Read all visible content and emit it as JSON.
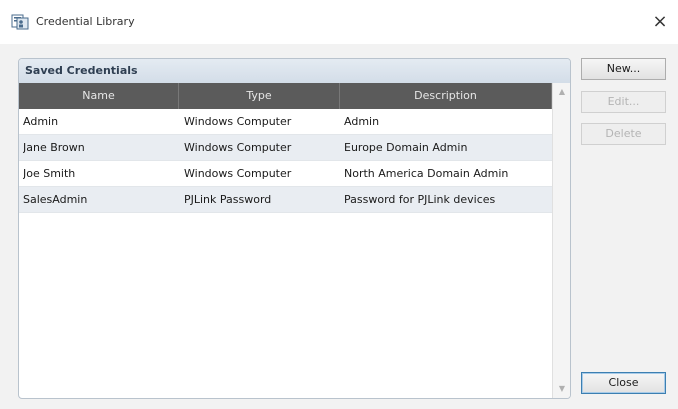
{
  "window": {
    "title": "Credential Library",
    "close_glyph": "×",
    "app_icon": "credential-library-icon"
  },
  "group": {
    "title": "Saved Credentials"
  },
  "table": {
    "columns": [
      "Name",
      "Type",
      "Description"
    ],
    "rows": [
      {
        "name": "Admin",
        "type": "Windows Computer",
        "description": "Admin"
      },
      {
        "name": "Jane Brown",
        "type": "Windows Computer",
        "description": "Europe Domain Admin"
      },
      {
        "name": "Joe Smith",
        "type": "Windows Computer",
        "description": "North America Domain Admin"
      },
      {
        "name": "SalesAdmin",
        "type": "PJLink Password",
        "description": "Password for PJLink devices"
      }
    ]
  },
  "buttons": {
    "new": "New...",
    "edit": "Edit...",
    "delete": "Delete",
    "close": "Close"
  },
  "colors": {
    "header_bg": "#5b5b5b",
    "group_header": "#d3dde8",
    "alt_row": "#e9edf2"
  }
}
